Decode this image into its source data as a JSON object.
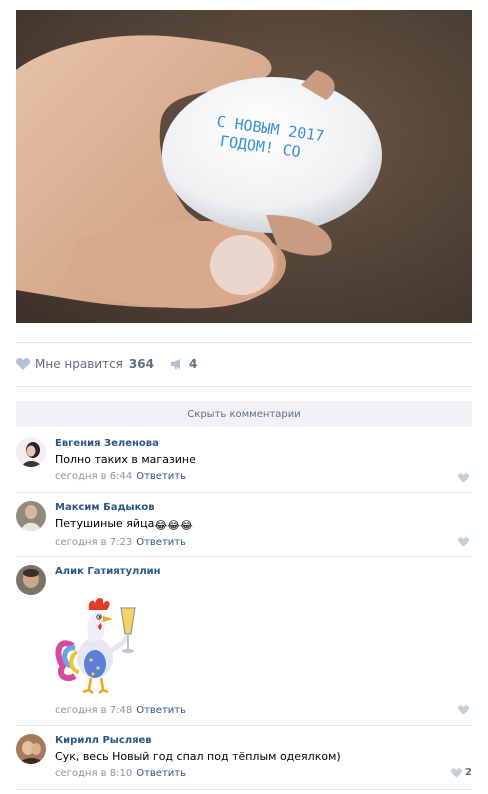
{
  "post": {
    "photo_text_line1": "С НОВЫМ 2017",
    "photo_text_line2": "ГОДОМ! СО",
    "likes_label": "Мне нравится",
    "likes_count": "364",
    "reposts_count": "4",
    "hide_comments": "Скрыть комментарии"
  },
  "comments": [
    {
      "author": "Евгения Зеленова",
      "text": "Полно таких в магазине",
      "time": "сегодня в 6:44",
      "reply": "Ответить",
      "likes": ""
    },
    {
      "author": "Максим Бадыков",
      "text": "Петушиные яйца",
      "emoji": "😂😂😂",
      "time": "сегодня в 7:23",
      "reply": "Ответить",
      "likes": ""
    },
    {
      "author": "Алик Гатиятуллин",
      "text": "",
      "sticker": "rooster-with-champagne",
      "time": "сегодня в 7:48",
      "reply": "Ответить",
      "likes": ""
    },
    {
      "author": "Кирилл Рысляев",
      "text": "Сук, весь Новый год спал под тёплым одеялком)",
      "time": "сегодня в 8:10",
      "reply": "Ответить",
      "likes": "2"
    }
  ],
  "colors": {
    "link": "#2a5885",
    "muted": "#939393",
    "separator": "#e7e8ec",
    "bar": "#f0f2f5",
    "stamp": "#3a8fd6"
  }
}
